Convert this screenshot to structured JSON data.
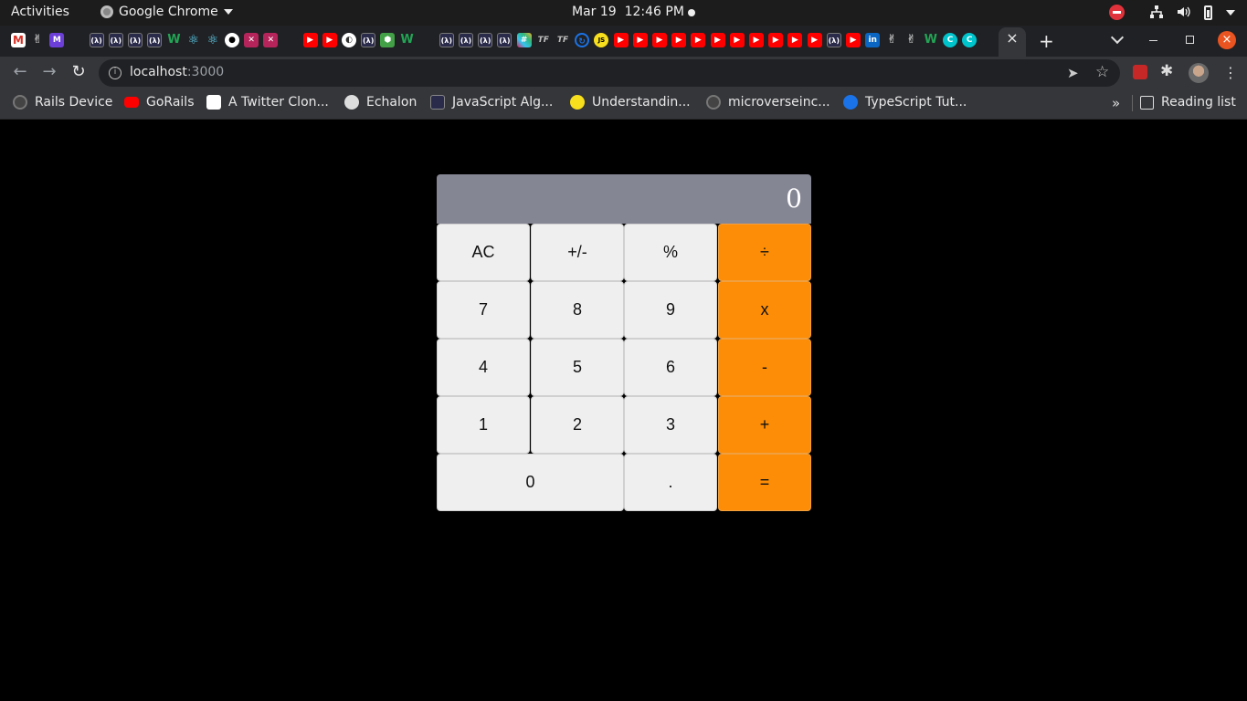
{
  "topbar": {
    "activities": "Activities",
    "app_name": "Google Chrome",
    "date": "Mar 19",
    "time": "12:46 PM"
  },
  "browser": {
    "tab_close": "×",
    "new_tab": "+",
    "window_close": "×",
    "url_host": "localhost",
    "url_port": ":3000",
    "nav_back": "←",
    "nav_forward": "→",
    "nav_reload": "↻",
    "info": "i",
    "send": "➤",
    "star": "☆",
    "puzzle": "✱",
    "menu": "⋮"
  },
  "tab_favicons": [
    {
      "icon": "gmail-icon",
      "glyph": "M"
    },
    {
      "icon": "peace-hand-icon",
      "glyph": "✌"
    },
    {
      "icon": "m-logo-icon",
      "glyph": "M"
    },
    {
      "icon": "lambda-icon",
      "glyph": "(λ)"
    },
    {
      "icon": "lambda-icon",
      "glyph": "(λ)"
    },
    {
      "icon": "lambda-icon",
      "glyph": "(λ)"
    },
    {
      "icon": "lambda-icon",
      "glyph": "(λ)"
    },
    {
      "icon": "w-logo-icon",
      "glyph": "W"
    },
    {
      "icon": "react-icon",
      "glyph": "⚛"
    },
    {
      "icon": "react-icon",
      "glyph": "⚛"
    },
    {
      "icon": "circle-logo-icon",
      "glyph": "●"
    },
    {
      "icon": "x-logo-icon",
      "glyph": "✕"
    },
    {
      "icon": "x-logo-icon",
      "glyph": "✕"
    },
    {
      "icon": "youtube-icon",
      "glyph": "▶"
    },
    {
      "icon": "youtube-icon",
      "glyph": "▶"
    },
    {
      "icon": "globe-icon",
      "glyph": "◐"
    },
    {
      "icon": "lambda-icon",
      "glyph": "(λ)"
    },
    {
      "icon": "node-icon",
      "glyph": "⬢"
    },
    {
      "icon": "w-logo-icon",
      "glyph": "W"
    },
    {
      "icon": "lambda-icon",
      "glyph": "(λ)"
    },
    {
      "icon": "lambda-icon",
      "glyph": "(λ)"
    },
    {
      "icon": "lambda-icon",
      "glyph": "(λ)"
    },
    {
      "icon": "lambda-icon",
      "glyph": "(λ)"
    },
    {
      "icon": "slack-icon",
      "glyph": "#"
    },
    {
      "icon": "tf-icon",
      "glyph": "TF"
    },
    {
      "icon": "tf-icon",
      "glyph": "TF"
    },
    {
      "icon": "sync-icon",
      "glyph": "↻"
    },
    {
      "icon": "js-icon",
      "glyph": "JS"
    },
    {
      "icon": "youtube-icon",
      "glyph": "▶"
    },
    {
      "icon": "youtube-icon",
      "glyph": "▶"
    },
    {
      "icon": "youtube-icon",
      "glyph": "▶"
    },
    {
      "icon": "youtube-icon",
      "glyph": "▶"
    },
    {
      "icon": "youtube-icon",
      "glyph": "▶"
    },
    {
      "icon": "youtube-icon",
      "glyph": "▶"
    },
    {
      "icon": "youtube-icon",
      "glyph": "▶"
    },
    {
      "icon": "youtube-icon",
      "glyph": "▶"
    },
    {
      "icon": "youtube-icon",
      "glyph": "▶"
    },
    {
      "icon": "youtube-icon",
      "glyph": "▶"
    },
    {
      "icon": "youtube-icon",
      "glyph": "▶"
    },
    {
      "icon": "lambda-icon",
      "glyph": "(λ)"
    },
    {
      "icon": "youtube-icon",
      "glyph": "▶"
    },
    {
      "icon": "linkedin-icon",
      "glyph": "in"
    },
    {
      "icon": "peace-hand-icon",
      "glyph": "✌"
    },
    {
      "icon": "peace-hand-icon",
      "glyph": "✌"
    },
    {
      "icon": "w-logo-icon",
      "glyph": "W"
    },
    {
      "icon": "canva-icon",
      "glyph": "C"
    },
    {
      "icon": "canva-icon",
      "glyph": "C"
    }
  ],
  "bookmarks": [
    {
      "label": "Rails Device",
      "icon": "github-icon"
    },
    {
      "label": "GoRails",
      "icon": "youtube-icon"
    },
    {
      "label": "A Twitter Clon...",
      "icon": "shield-icon"
    },
    {
      "label": "Echalon",
      "icon": "globe-icon"
    },
    {
      "label": "JavaScript Alg...",
      "icon": "lambda-icon"
    },
    {
      "label": "Understandin...",
      "icon": "js-icon"
    },
    {
      "label": "microverseinc...",
      "icon": "github-icon"
    },
    {
      "label": "TypeScript Tut...",
      "icon": "typescript-icon"
    }
  ],
  "bookmarks_more": "»",
  "reading_list": "Reading list",
  "calculator": {
    "display": "0",
    "keys": {
      "ac": "AC",
      "sign": "+/-",
      "percent": "%",
      "divide": "÷",
      "seven": "7",
      "eight": "8",
      "nine": "9",
      "multiply": "x",
      "four": "4",
      "five": "5",
      "six": "6",
      "minus": "-",
      "one": "1",
      "two": "2",
      "three": "3",
      "plus": "+",
      "zero": "0",
      "dot": ".",
      "equals": "="
    }
  },
  "colors": {
    "page_bg": "#000000",
    "display_bg": "#858694",
    "key_bg": "#efefef",
    "operator_bg": "#fd8d07"
  }
}
